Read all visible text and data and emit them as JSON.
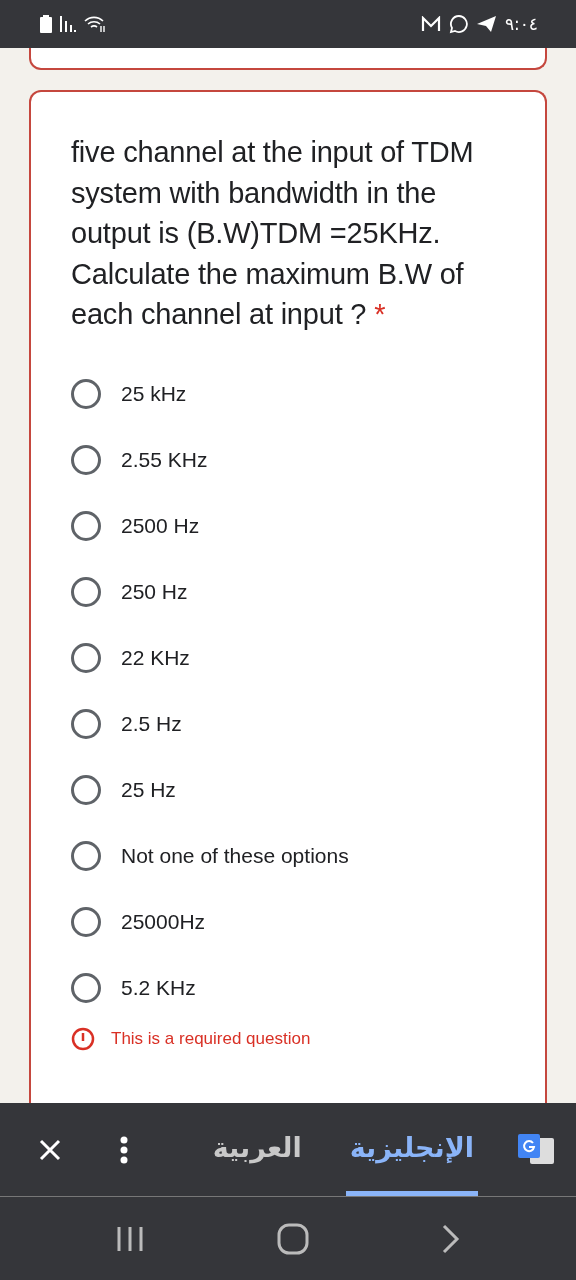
{
  "status_bar": {
    "time": "٩:٠٤"
  },
  "question": {
    "text": "five channel at the input of TDM system with bandwidth in the output is (B.W)TDM =25KHz. Calculate the maximum B.W of each channel at input ?",
    "required_mark": "*",
    "options": [
      {
        "label": "25 kHz",
        "selected": false
      },
      {
        "label": "2.55 KHz",
        "selected": false
      },
      {
        "label": "2500 Hz",
        "selected": false
      },
      {
        "label": "250 Hz",
        "selected": false
      },
      {
        "label": "22 KHz",
        "selected": false
      },
      {
        "label": "2.5 Hz",
        "selected": false
      },
      {
        "label": "25 Hz",
        "selected": false
      },
      {
        "label": "Not one of these options",
        "selected": false
      },
      {
        "label": "25000Hz",
        "selected": false
      },
      {
        "label": "5.2 KHz",
        "selected": false
      }
    ],
    "error": "This is a required question"
  },
  "translate_bar": {
    "languages": [
      {
        "label": "الإنجليزية",
        "selected": true
      },
      {
        "label": "العربية",
        "selected": false
      }
    ]
  }
}
